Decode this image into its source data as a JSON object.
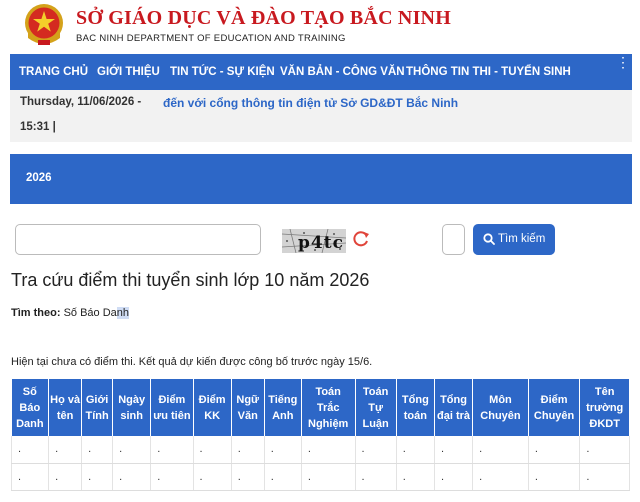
{
  "header": {
    "title": "SỞ GIÁO DỤC VÀ ĐÀO TẠO BẮC NINH",
    "subtitle": "BAC NINH DEPARTMENT OF EDUCATION AND TRAINING"
  },
  "nav": {
    "items": [
      {
        "label": "TRANG CHỦ"
      },
      {
        "label": "GIỚI THIỆU"
      },
      {
        "label": "TIN TỨC - SỰ KIỆN"
      },
      {
        "label": "VĂN BẢN - CÔNG VĂN"
      },
      {
        "label": "THÔNG TIN THI - TUYỂN SINH"
      }
    ],
    "more_icon": "more-vertical-icon"
  },
  "topbar": {
    "date": "Thursday, 11/06/2026  -",
    "time": "15:31  |",
    "marquee": "đến với cổng thông tin điện tử Sở GD&ĐT Bắc Ninh"
  },
  "year_tab": "2026",
  "search": {
    "input_value": "",
    "captcha_text": "p4tc",
    "captcha_input_value": "",
    "button_label": "Tìm kiếm",
    "refresh_icon": "refresh-icon",
    "search_icon": "search-icon"
  },
  "page": {
    "heading": "Tra cứu điểm thi tuyển sinh lớp 10 năm 2026",
    "search_by_label": "Tìm theo:",
    "search_by_value_a": "Số Báo Da",
    "search_by_value_b": "nh",
    "notice": "Hiện tại chưa có điểm thi. Kết quả dự kiến được công bố trước ngày 15/6."
  },
  "table": {
    "headers": [
      "Số Báo Danh",
      "Họ và tên",
      "Giới Tính",
      "Ngày sinh",
      "Điểm ưu tiên",
      "Điểm KK",
      "Ngữ Văn",
      "Tiếng Anh",
      "Toán Trắc Nghiệm",
      "Toán Tự Luận",
      "Tổng toán",
      "Tổng đại trà",
      "Môn Chuyên",
      "Điểm Chuyên",
      "Tên trường ĐKDT"
    ],
    "rows": [
      [
        ".",
        ".",
        ".",
        ".",
        ".",
        ".",
        ".",
        ".",
        ".",
        ".",
        ".",
        ".",
        ".",
        ".",
        "."
      ],
      [
        ".",
        ".",
        ".",
        ".",
        ".",
        ".",
        ".",
        ".",
        ".",
        ".",
        ".",
        ".",
        ".",
        ".",
        "."
      ]
    ]
  },
  "colors": {
    "primary": "#2d67c7",
    "title_red": "#c8191f",
    "refresh_red": "#e0443a",
    "topbar_bg": "#f2f2f2"
  }
}
